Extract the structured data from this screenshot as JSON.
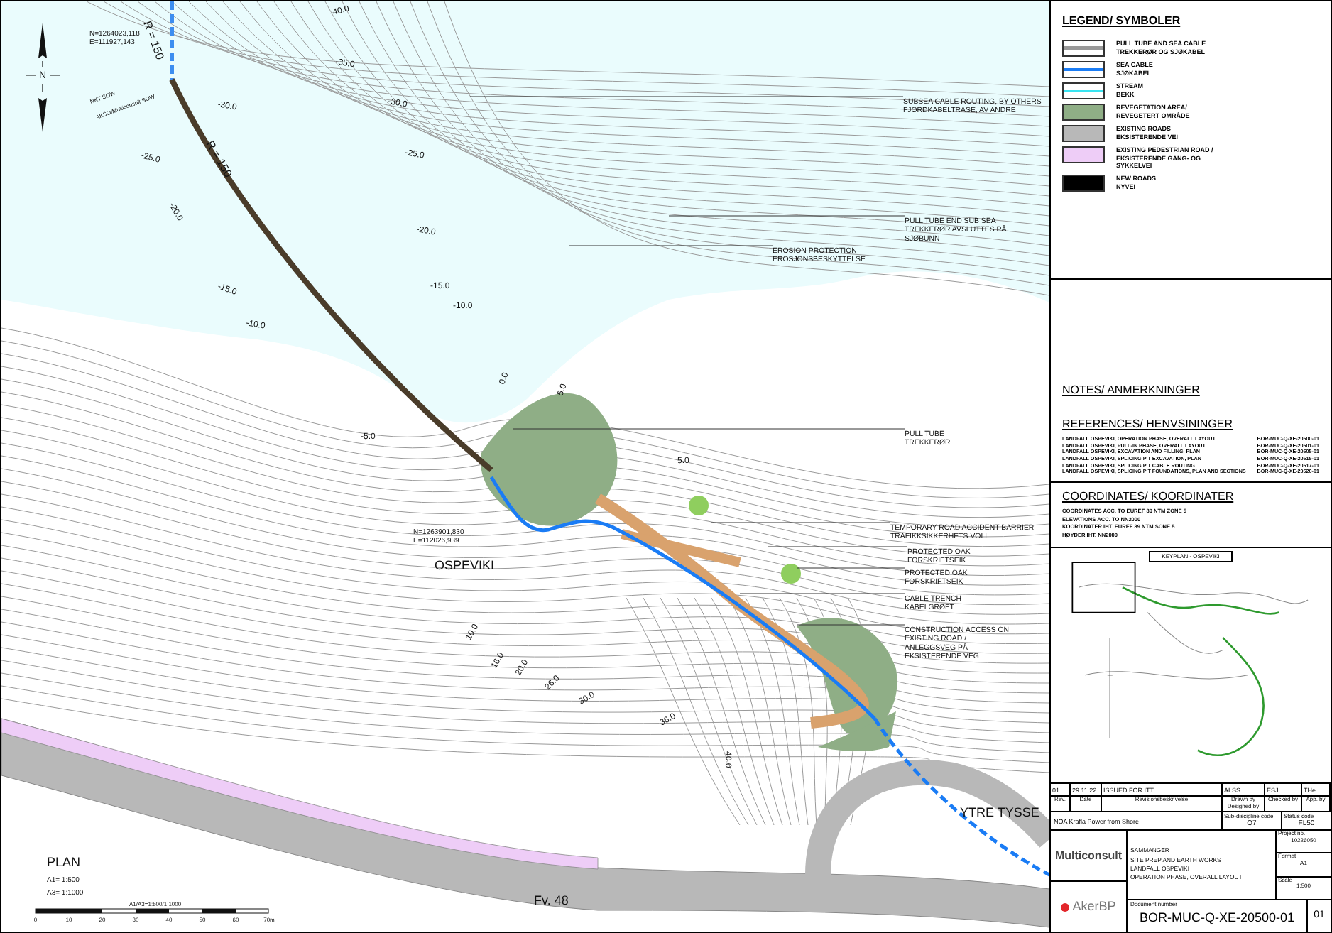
{
  "map": {
    "north_label": "N",
    "coordinates": [
      {
        "lines": [
          "N=1264023,118",
          "E=111927,143"
        ]
      },
      {
        "lines": [
          "N=1263901,830",
          "E=112026,939"
        ]
      }
    ],
    "boundary_labels": [
      "NKT SOW",
      "AKSO/Multiconsult SOW"
    ],
    "radius_labels": [
      "R = 150",
      "R = 150"
    ],
    "depth_labels": [
      "-40.0",
      "-35.0",
      "-30.0",
      "-30.0",
      "-25.0",
      "-25.0",
      "-20.0",
      "-20.0",
      "-15.0",
      "-15.0",
      "-10.0",
      "-10.0",
      "-5.0",
      "0.0",
      "5.0",
      "5.0",
      "10.0",
      "16.0",
      "20.0",
      "26.0",
      "30.0",
      "36.0",
      "40.0"
    ],
    "callouts": [
      {
        "lines": [
          "SUBSEA CABLE ROUTING, BY OTHERS",
          "FJORDKABELTRASE, AV ANDRE"
        ]
      },
      {
        "lines": [
          "PULL TUBE END SUB SEA",
          "TREKKERØR AVSLUTTES PÅ",
          "SJØBUNN"
        ]
      },
      {
        "lines": [
          "EROSION PROTECTION",
          "EROSJONSBESKYTTELSE"
        ]
      },
      {
        "lines": [
          "PULL TUBE",
          "TREKKERØR"
        ]
      },
      {
        "lines": [
          "TEMPORARY ROAD ACCIDENT BARRIER",
          "TRAFIKKSIKKERHETS VOLL"
        ]
      },
      {
        "lines": [
          "PROTECTED OAK",
          "FORSKRIFTSEIK"
        ]
      },
      {
        "lines": [
          "PROTECTED OAK",
          "FORSKRIFTSEIK"
        ]
      },
      {
        "lines": [
          "CABLE TRENCH",
          "KABELGRØFT"
        ]
      },
      {
        "lines": [
          "CONSTRUCTION ACCESS ON",
          "EXISTING ROAD /",
          "ANLEGGSVEG PÅ",
          "EKSISTERENDE VEG"
        ]
      }
    ],
    "place_names": [
      "OSPEVIKI",
      "YTRE TYSSE",
      "Fv. 48"
    ],
    "plan": {
      "title": "PLAN",
      "scales": [
        "A1= 1:500",
        "A3= 1:1000"
      ],
      "bar_title": "A1/A3=1:500/1:1000",
      "bar_ticks": [
        "0",
        "10",
        "20",
        "30",
        "40",
        "50",
        "60",
        "70m"
      ]
    }
  },
  "legend": {
    "title": "LEGEND/ SYMBOLER",
    "items": [
      {
        "kind": "pull_tube",
        "lines": [
          "PULL TUBE AND SEA CABLE",
          "TREKKERØR OG SJØKABEL"
        ]
      },
      {
        "kind": "sea_cable",
        "lines": [
          "SEA CABLE",
          "SJØKABEL"
        ]
      },
      {
        "kind": "stream",
        "lines": [
          "STREAM",
          "BEKK"
        ]
      },
      {
        "kind": "revegetation",
        "lines": [
          "REVEGETATION AREA/",
          "REVEGETERT OMRÅDE"
        ]
      },
      {
        "kind": "existing_road",
        "lines": [
          "EXISTING ROADS",
          "EKSISTERENDE VEI"
        ]
      },
      {
        "kind": "pedestrian_road",
        "lines": [
          "EXISTING PEDESTRIAN ROAD /",
          "EKSISTERENDE GANG- OG",
          "SYKKELVEI"
        ]
      },
      {
        "kind": "new_road",
        "lines": [
          "NEW ROADS",
          "NYVEI"
        ]
      }
    ]
  },
  "notes": {
    "title": "NOTES/ ANMERKNINGER"
  },
  "references": {
    "title": "REFERENCES/ HENVSININGER",
    "rows": [
      {
        "title": "LANDFALL OSPEVIKI, OPERATION PHASE, OVERALL LAYOUT",
        "number": "BOR-MUC-Q-XE-20500-01"
      },
      {
        "title": "LANDFALL OSPEVIKI, PULL-IN PHASE, OVERALL LAYOUT",
        "number": "BOR-MUC-Q-XE-20501-01"
      },
      {
        "title": "LANDFALL OSPEVIKI, EXCAVATION AND FILLING, PLAN",
        "number": "BOR-MUC-Q-XE-20505-01"
      },
      {
        "title": "LANDFALL OSPEVIKI, SPLICING PIT EXCAVATION, PLAN",
        "number": "BOR-MUC-Q-XE-20515-01"
      },
      {
        "title": "LANDFALL OSPEVIKI, SPLICING PIT CABLE ROUTING",
        "number": "BOR-MUC-Q-XE-20517-01"
      },
      {
        "title": "LANDFALL OSPEVIKI, SPLICING PIT FOUNDATIONS, PLAN AND SECTIONS",
        "number": "BOR-MUC-Q-XE-20520-01"
      }
    ]
  },
  "coordinates": {
    "title": "COORDINATES/ KOORDINATER",
    "lines": [
      "COORDINATES ACC. TO EUREF 89 NTM ZONE 5",
      "ELEVATIONS ACC. TO NN2000",
      "KOORDINATER IHT. EUREF 89 NTM SONE 5",
      "HØYDER IHT. NN2000"
    ]
  },
  "keyplan": {
    "title": "KEYPLAN - OSPEVIKI"
  },
  "title_block": {
    "revision": {
      "rev": "01",
      "date": "29.11.22",
      "description": "ISSUED FOR ITT",
      "drawn": "ALSS",
      "checked": "ESJ",
      "approved": "THe"
    },
    "headers": [
      "Rev.",
      "Date",
      "Revisjonsbeskrivelse",
      "Drawn by Designed by",
      "Checked by",
      "App. by"
    ],
    "project": "NOA Krafla Power from Shore",
    "subdiscipline_label": "Sub-discipline code",
    "subdiscipline": "Q7",
    "status_label": "Status code",
    "status": "FL50",
    "company": "Multiconsult",
    "lines": [
      "SAMMANGER",
      "SITE PREP AND EARTH WORKS",
      "LANDFALL OSPEVIKI",
      "OPERATION PHASE, OVERALL LAYOUT"
    ],
    "project_no_label": "Project no.",
    "project_no": "10226050",
    "format_label": "Format",
    "format": "A1",
    "scale_label": "Scale",
    "scale": "1:500",
    "client": "AkerBP",
    "document_label": "Document number",
    "document": "BOR-MUC-Q-XE-20500-01",
    "doc_rev": "01"
  }
}
